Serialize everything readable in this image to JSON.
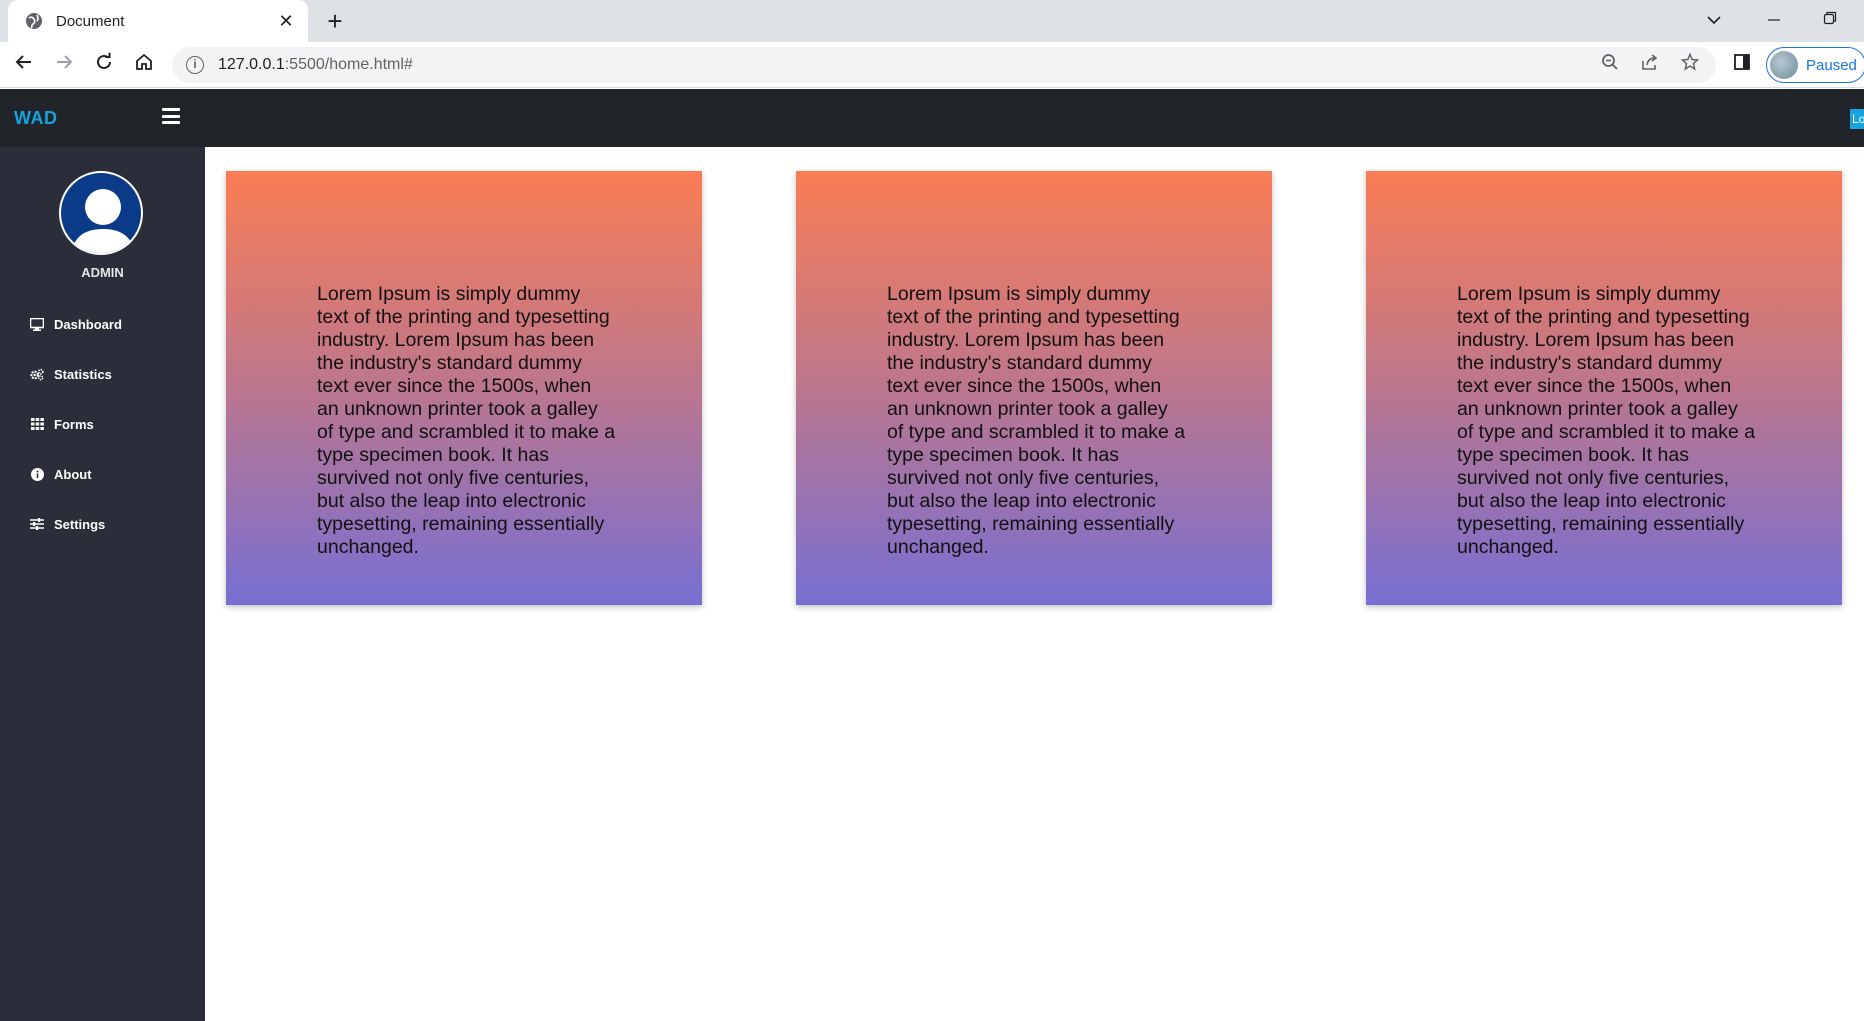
{
  "browser": {
    "tab_title": "Document",
    "tab_close": "✕",
    "new_tab": "+",
    "url_host": "127.0.0.1",
    "url_path": ":5500/home.html#",
    "profile_label": "Paused",
    "icons": [
      "globe-icon",
      "back-icon",
      "forward-icon",
      "reload-icon",
      "home-icon",
      "info-icon",
      "zoom-icon",
      "share-icon",
      "star-icon",
      "sidepanel-icon",
      "chevron-down-icon",
      "minimize-icon",
      "restore-icon"
    ]
  },
  "header": {
    "brand": "WAD",
    "badge": "Lo"
  },
  "sidebar": {
    "user": "ADMIN",
    "items": [
      {
        "label": "Dashboard",
        "icon": "monitor-icon"
      },
      {
        "label": "Statistics",
        "icon": "cogs-icon"
      },
      {
        "label": "Forms",
        "icon": "grid-icon"
      },
      {
        "label": "About",
        "icon": "info-circle-icon"
      },
      {
        "label": "Settings",
        "icon": "sliders-icon"
      }
    ]
  },
  "cards": [
    {
      "text": "Lorem Ipsum is simply dummy text of the printing and typesetting industry. Lorem Ipsum has been the industry's standard dummy text ever since the 1500s, when an unknown printer took a galley of type and scrambled it to make a type specimen book. It has survived not only five centuries, but also the leap into electronic typesetting, remaining essentially unchanged."
    },
    {
      "text": "Lorem Ipsum is simply dummy text of the printing and typesetting industry. Lorem Ipsum has been the industry's standard dummy text ever since the 1500s, when an unknown printer took a galley of type and scrambled it to make a type specimen book. It has survived not only five centuries, but also the leap into electronic typesetting, remaining essentially unchanged."
    },
    {
      "text": "Lorem Ipsum is simply dummy text of the printing and typesetting industry. Lorem Ipsum has been the industry's standard dummy text ever since the 1500s, when an unknown printer took a galley of type and scrambled it to make a type specimen book. It has survived not only five centuries, but also the leap into electronic typesetting, remaining essentially unchanged."
    }
  ],
  "colors": {
    "header_bg": "#212529",
    "sidebar_bg": "#2b2e38",
    "brand": "#17a2e0",
    "card_top": "#fa7d55",
    "card_bottom": "#776fd2"
  }
}
